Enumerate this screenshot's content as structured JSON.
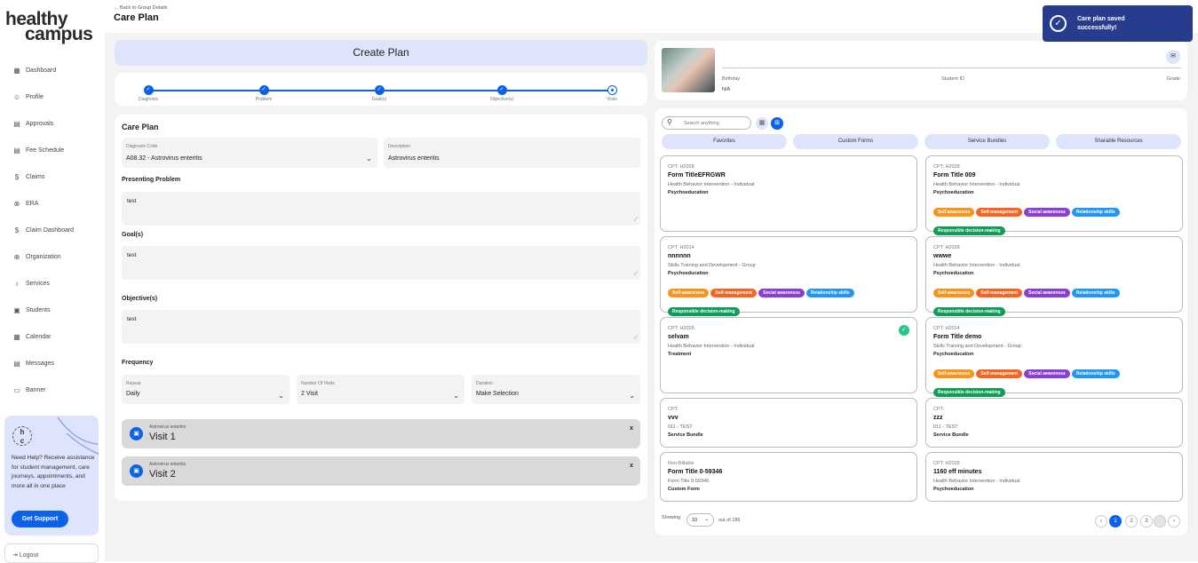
{
  "brand": {
    "line1": "healthy",
    "line2": "campus"
  },
  "sidebar": {
    "items": [
      {
        "icon": "grid-icon",
        "label": "Dashboard"
      },
      {
        "icon": "user-icon",
        "label": "Profile"
      },
      {
        "icon": "approvals-icon",
        "label": "Approvals"
      },
      {
        "icon": "fee-icon",
        "label": "Fee Schedule"
      },
      {
        "icon": "claims-icon",
        "label": "Claims"
      },
      {
        "icon": "era-icon",
        "label": "ERA"
      },
      {
        "icon": "claim-dashboard-icon",
        "label": "Claim Dashboard"
      },
      {
        "icon": "globe-icon",
        "label": "Organization"
      },
      {
        "icon": "stethoscope-icon",
        "label": "Services"
      },
      {
        "icon": "student-icon",
        "label": "Students"
      },
      {
        "icon": "calendar-icon",
        "label": "Calendar"
      },
      {
        "icon": "message-icon",
        "label": "Messages"
      },
      {
        "icon": "banner-icon",
        "label": "Banner"
      }
    ],
    "help": {
      "text": "Need Help? Receive assistance for student management, care journeys, appointments, and more all in one place",
      "button": "Get Support"
    },
    "logout": "Logout"
  },
  "header": {
    "back": "Back to Group Details",
    "title": "Care Plan"
  },
  "create_plan": "Create Plan",
  "stepper": {
    "steps": [
      "Diagnosis",
      "Problem",
      "Goal(s)",
      "Objective(s)",
      "Visits"
    ]
  },
  "plan": {
    "title": "Care Plan",
    "diagnosis_label": "Diagnosis Code",
    "diagnosis_value": "A08.32 - Astrovirus enteritis",
    "description_label": "Description",
    "description_value": "Astrovirus enteritis",
    "presenting_label": "Presenting Problem",
    "presenting_value": "test",
    "goals_label": "Goal(s)",
    "goals_value": "test",
    "objectives_label": "Objective(s)",
    "objectives_value": "test",
    "frequency_label": "Frequency",
    "repeat_label": "Repeat",
    "repeat_value": "Daily",
    "visits_label": "Number Of Visits",
    "visits_value": "2 Visit",
    "duration_label": "Duration",
    "duration_value": "Make Selection",
    "visit_items": [
      {
        "sub": "Astrovirus enteritis",
        "title": "Visit 1",
        "close": "x"
      },
      {
        "sub": "Astrovirus enteritis",
        "title": "Visit 2",
        "close": "x"
      }
    ]
  },
  "profile": {
    "birthday_label": "Birthday",
    "birthday_value": "N/A",
    "student_id_label": "Student ID",
    "grade_label": "Grade"
  },
  "forms": {
    "search_placeholder": "Search anything",
    "tabs": [
      "Favorites",
      "Custom Forms",
      "Service Bundles",
      "Sharable Resources"
    ],
    "cards": [
      {
        "code": "CPT: H2028",
        "title": "Form TitleEFRGWR",
        "subtitle": "Health Behavior Intervention - Individual",
        "category": "Psychoeducation",
        "tags": [],
        "checked": false
      },
      {
        "code": "CPT: H2028",
        "title": "Form Title  009",
        "subtitle": "Health Behavior Intervention - Individual",
        "category": "Psychoeducation",
        "tags": [
          "Self-awareness",
          "Self-management",
          "Social awareness",
          "Relationship skills",
          "Responsible decision-making"
        ],
        "checked": false
      },
      {
        "code": "CPT: H2014",
        "title": "nnnnnn",
        "subtitle": "Skills Training and Development - Group",
        "category": "Psychoeducation",
        "tags": [
          "Self-awareness",
          "Self-management",
          "Social awareness",
          "Relationship skills",
          "Responsible decision-making"
        ],
        "checked": false
      },
      {
        "code": "CPT: H2028",
        "title": "wwwe",
        "subtitle": "Health Behavior Intervention - Individual",
        "category": "Psychoeducation",
        "tags": [
          "Self-awareness",
          "Self-management",
          "Social awareness",
          "Relationship skills",
          "Responsible decision-making"
        ],
        "checked": false
      },
      {
        "code": "CPT: H2028",
        "title": "selvam",
        "subtitle": "Health Behavior Intervention - Individual",
        "category": "Treatment",
        "tags": [],
        "checked": true
      },
      {
        "code": "CPT: H2014",
        "title": "Form Title demo",
        "subtitle": "Skills Training and Development - Group",
        "category": "Psychoeducation",
        "tags": [
          "Self-awareness",
          "Self-management",
          "Social awareness",
          "Relationship skills",
          "Responsible decision-making"
        ],
        "checked": false
      },
      {
        "code": "CPT:",
        "title": "vvv",
        "subtitle": "011 - TEST",
        "category": "Service Bundle",
        "tags": [],
        "checked": false
      },
      {
        "code": "CPT:",
        "title": "zzz",
        "subtitle": "011 - TEST",
        "category": "Service Bundle",
        "tags": [],
        "checked": false
      },
      {
        "code": "Non-Billable",
        "title": "Form Title 0-59346",
        "subtitle": "Form Title 0-59346",
        "category": "Custom Form",
        "tags": [],
        "checked": false
      },
      {
        "code": "CPT: H2028",
        "title": "1160 eff minutes",
        "subtitle": "Health Behavior Intervention - Individual",
        "category": "Psychoeducation",
        "tags": [],
        "checked": false
      }
    ],
    "tag_colors": {
      "Self-awareness": "#f7941d",
      "Self-management": "#f26522",
      "Social awareness": "#8a3fd1",
      "Relationship skills": "#2196f3",
      "Responsible decision-making": "#0f9d58"
    },
    "showing_label": "Showing",
    "page_size": "10",
    "out_of": "out of 185",
    "pages": [
      "1",
      "2",
      "3"
    ]
  },
  "toast": {
    "message": "Care plan saved successfully!"
  }
}
